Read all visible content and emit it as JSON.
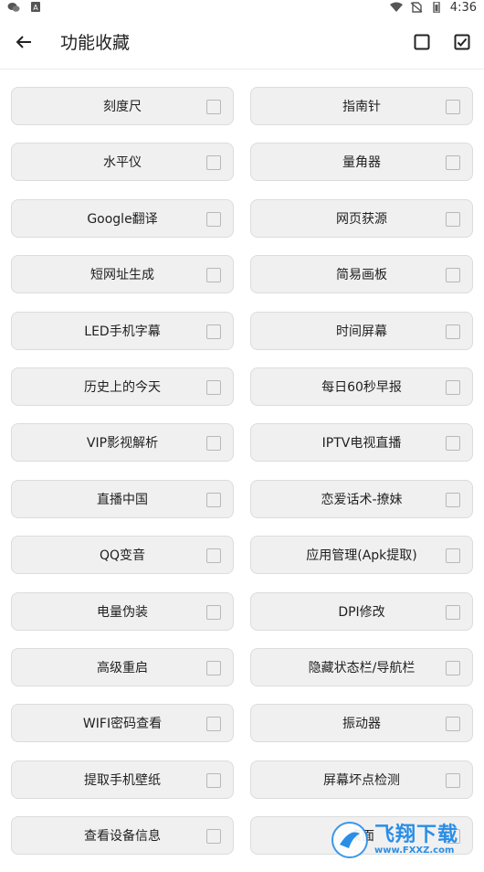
{
  "status_bar": {
    "time": "4:36",
    "left_icons": [
      "wechat-icon",
      "app-notification-icon"
    ],
    "right_icons": [
      "wifi-icon",
      "no-sim-icon",
      "battery-icon"
    ]
  },
  "app_bar": {
    "title": "功能收藏",
    "back_icon": "arrow-left-icon",
    "deselect_all_icon": "checkbox-empty-icon",
    "select_all_icon": "checkbox-checked-icon"
  },
  "tools": [
    {
      "label": "刻度尺",
      "checked": false
    },
    {
      "label": "指南针",
      "checked": false
    },
    {
      "label": "水平仪",
      "checked": false
    },
    {
      "label": "量角器",
      "checked": false
    },
    {
      "label": "Google翻译",
      "checked": false
    },
    {
      "label": "网页获源",
      "checked": false
    },
    {
      "label": "短网址生成",
      "checked": false
    },
    {
      "label": "简易画板",
      "checked": false
    },
    {
      "label": "LED手机字幕",
      "checked": false
    },
    {
      "label": "时间屏幕",
      "checked": false
    },
    {
      "label": "历史上的今天",
      "checked": false
    },
    {
      "label": "每日60秒早报",
      "checked": false
    },
    {
      "label": "VIP影视解析",
      "checked": false
    },
    {
      "label": "IPTV电视直播",
      "checked": false
    },
    {
      "label": "直播中国",
      "checked": false
    },
    {
      "label": "恋爱话术-撩妹",
      "checked": false
    },
    {
      "label": "QQ变音",
      "checked": false
    },
    {
      "label": "应用管理(Apk提取)",
      "checked": false
    },
    {
      "label": "电量伪装",
      "checked": false
    },
    {
      "label": "DPI修改",
      "checked": false
    },
    {
      "label": "高级重启",
      "checked": false
    },
    {
      "label": "隐藏状态栏/导航栏",
      "checked": false
    },
    {
      "label": "WIFI密码查看",
      "checked": false
    },
    {
      "label": "振动器",
      "checked": false
    },
    {
      "label": "提取手机壁纸",
      "checked": false
    },
    {
      "label": "屏幕坏点检测",
      "checked": false
    },
    {
      "label": "查看设备信息",
      "checked": false
    },
    {
      "label": "桌面",
      "checked": false
    }
  ],
  "watermark": {
    "text": "飞翔下载",
    "url": "www.FXXZ.com"
  }
}
